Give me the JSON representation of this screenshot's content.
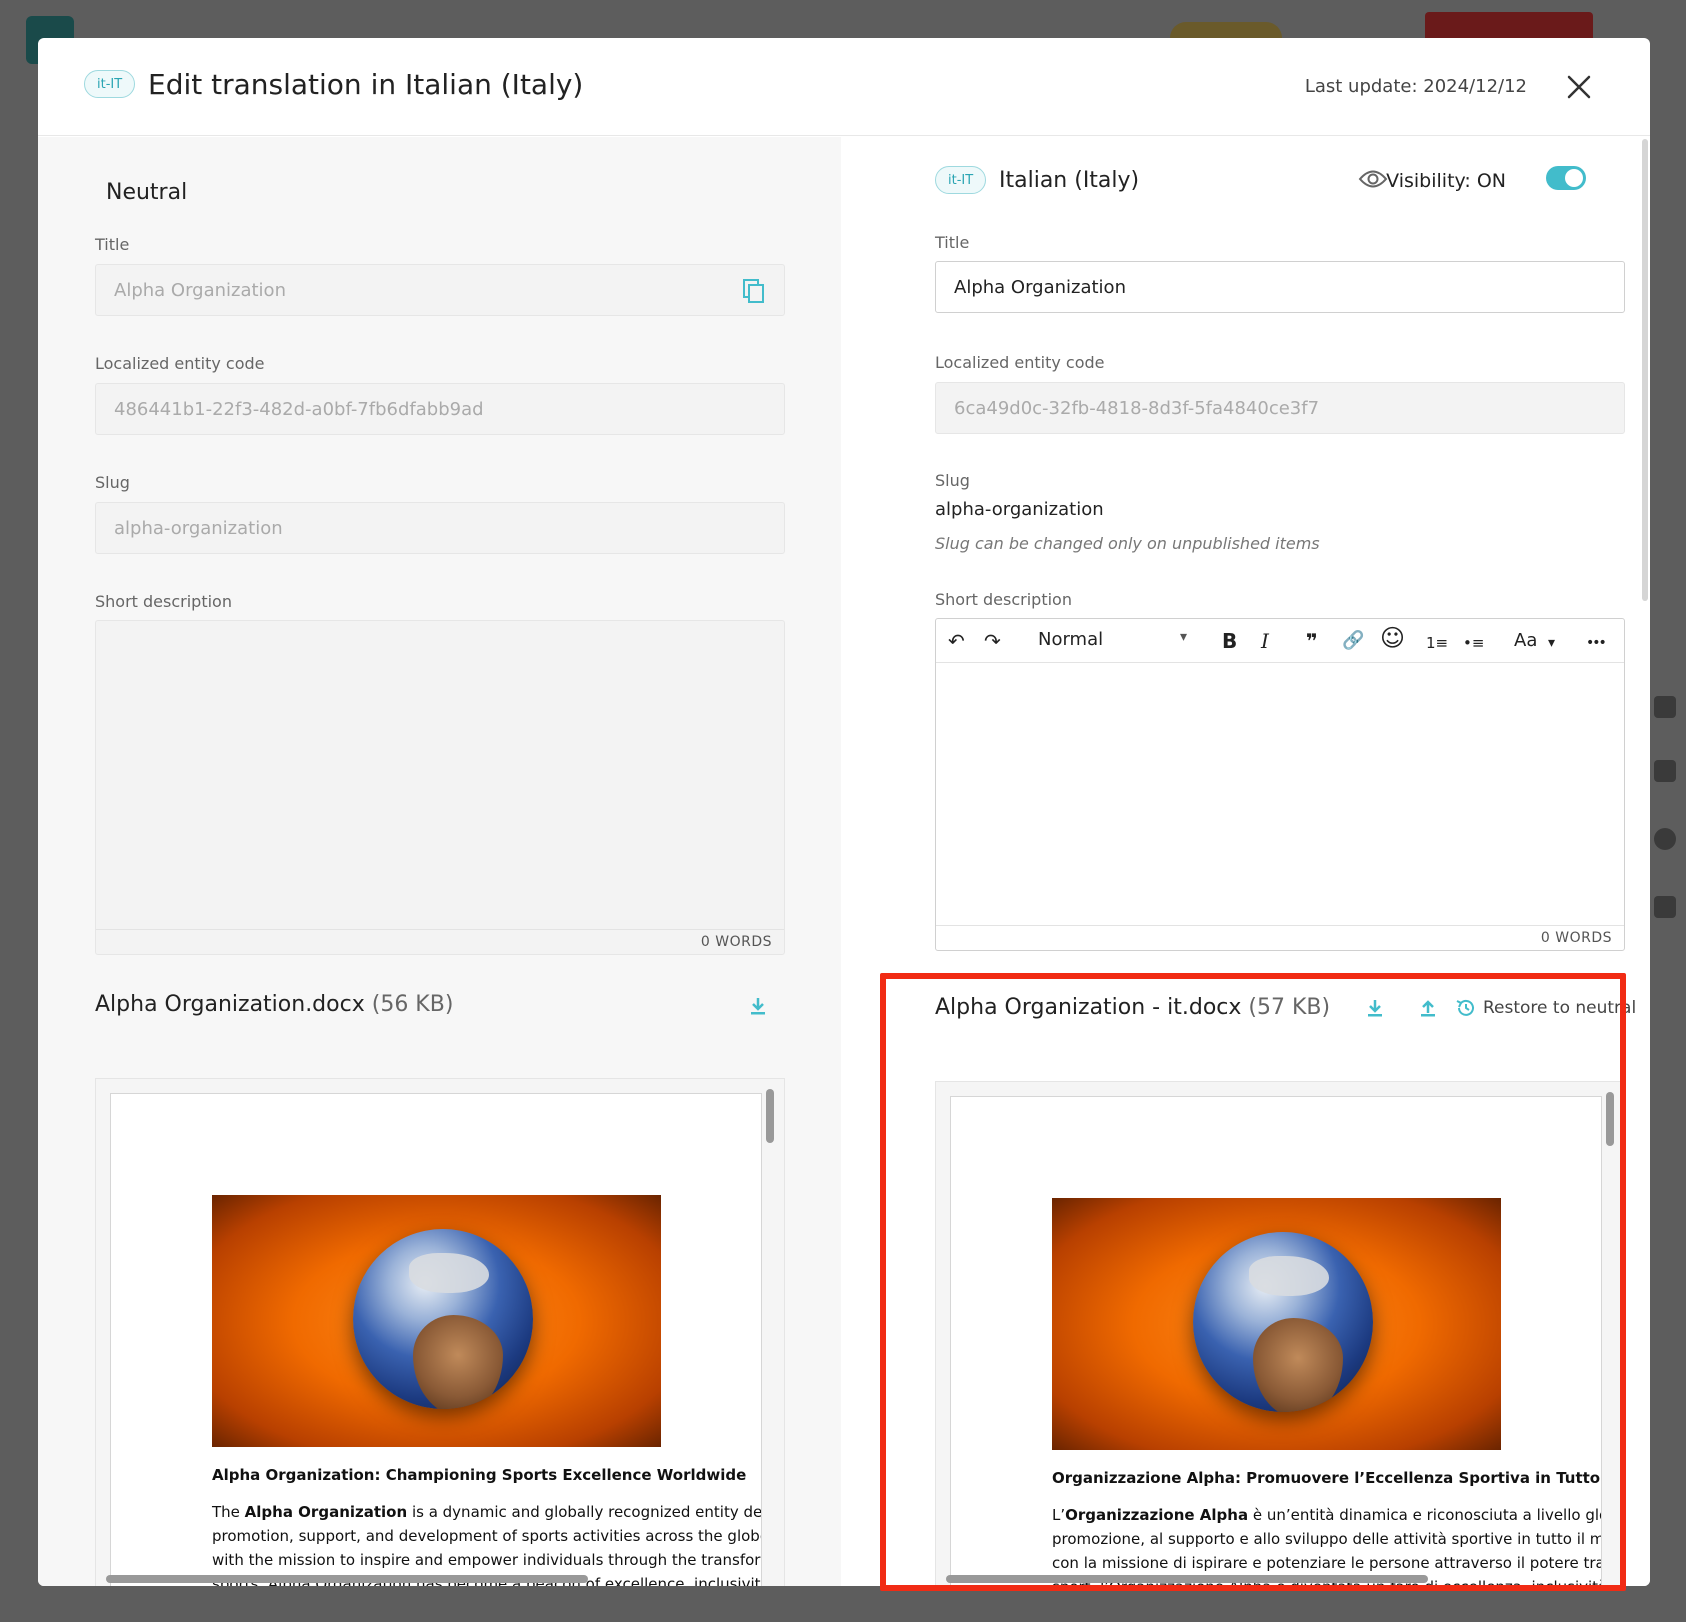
{
  "modal": {
    "locale_badge": "it-IT",
    "title": "Edit translation in Italian (Italy)",
    "last_update": "Last update: 2024/12/12"
  },
  "neutral": {
    "heading": "Neutral",
    "title_label": "Title",
    "title_value": "Alpha Organization",
    "code_label": "Localized entity code",
    "code_value": "486441b1-22f3-482d-a0bf-7fb6dfabb9ad",
    "slug_label": "Slug",
    "slug_value": "alpha-organization",
    "short_desc_label": "Short description",
    "words": "0 WORDS",
    "file_name": "Alpha Organization.docx",
    "file_size": "(56 KB)",
    "doc_heading": "Alpha Organization: Championing Sports Excellence Worldwide",
    "doc_lines": [
      "is a dynamic and globally recognized entity dedicated to the",
      "promotion, support, and development of sports activities across the globe. Established",
      "with the mission to inspire and empower individuals through the transformative power of",
      "sports, Alpha Organization has become a beacon of excellence, inclusivity, and"
    ],
    "doc_line1_prefix": "The ",
    "doc_line1_bold": "Alpha Organization"
  },
  "italian": {
    "locale_badge": "it-IT",
    "heading": "Italian (Italy)",
    "visibility": "Visibility: ON",
    "title_label": "Title",
    "title_value": "Alpha Organization",
    "code_label": "Localized entity code",
    "code_value": "6ca49d0c-32fb-4818-8d3f-5fa4840ce3f7",
    "slug_label": "Slug",
    "slug_value": "alpha-organization",
    "slug_hint": "Slug can be changed only on unpublished items",
    "short_desc_label": "Short description",
    "editor_style": "Normal",
    "words": "0 WORDS",
    "file_name": "Alpha Organization - it.docx",
    "file_size": "(57 KB)",
    "restore_label": "Restore to neutral",
    "doc_heading": "Organizzazione Alpha: Promuovere l’Eccellenza Sportiva in Tutto il Mondo",
    "doc_lines": [
      "è un’entità dinamica e riconosciuta a livello globale, dedicata alla",
      "promozione, al supporto e allo sviluppo delle attività sportive in tutto il mondo. Fondata",
      "con la missione di ispirare e potenziare le persone attraverso il potere trasformativo dello",
      "sport, l’Organizzazione Alpha è diventata un faro di eccellenza, inclusività e innovazione"
    ],
    "doc_line1_prefix": "L’",
    "doc_line1_bold": "Organizzazione Alpha"
  },
  "toolbar": {
    "undo": "↶",
    "redo": "↷",
    "bold": "B",
    "italic": "I",
    "quote": "❞",
    "link": "🔗",
    "emoji": "☺",
    "ordered_list": "1≡",
    "bullet_list": "•≡",
    "font": "Aa",
    "more": "•••"
  },
  "colors": {
    "accent": "#42bccb",
    "highlight": "#f12b14"
  }
}
